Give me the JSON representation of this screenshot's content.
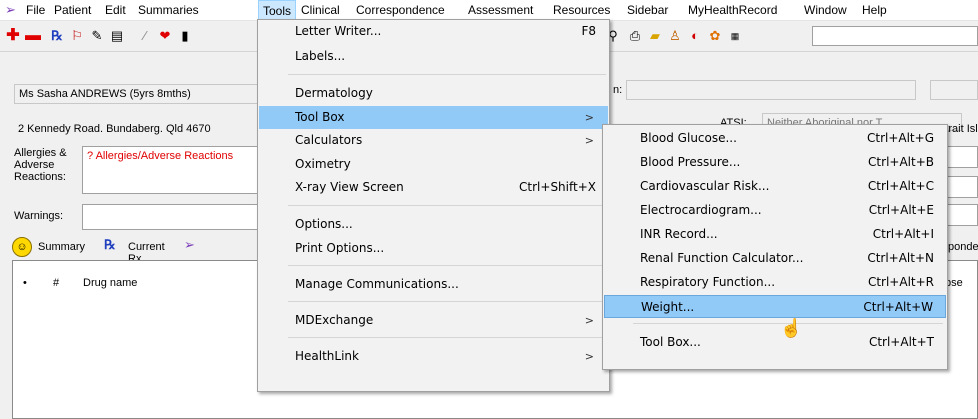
{
  "menubar": {
    "items": [
      "File",
      "Patient",
      "Edit",
      "Summaries",
      "Tools",
      "Clinical",
      "Correspondence",
      "Assessment",
      "Resources",
      "Sidebar",
      "MyHealthRecord",
      "Window",
      "Help"
    ]
  },
  "patient": {
    "name": "Ms Sasha ANDREWS (5yrs 8mths)",
    "address": "2 Kennedy Road. Bundaberg. Qld  4670",
    "allergies_label": "Allergies & Adverse Reactions:",
    "allergies_value": "? Allergies/Adverse Reactions",
    "warnings_label": "Warnings:",
    "atsi_label": "ATSI:",
    "atsi_value": "Neither Aboriginal nor T",
    "atsi_right": "Strait Isl",
    "partial_colon": "n:"
  },
  "tabs": {
    "summary": "Summary",
    "current_rx": "Current Rx",
    "right_partial": "ponde"
  },
  "list": {
    "col_bullet": "•",
    "col_hash": "#",
    "col_drug": "Drug name",
    "col_right": "pse"
  },
  "tools_menu": {
    "items": [
      {
        "label": "Letter Writer...",
        "shortcut": "F8"
      },
      {
        "label": "Labels..."
      },
      {
        "label": "Dermatology"
      },
      {
        "label": "Tool Box",
        "submenu": true
      },
      {
        "label": "Calculators",
        "submenu": true
      },
      {
        "label": "Oximetry"
      },
      {
        "label": "X-ray View Screen",
        "shortcut": "Ctrl+Shift+X"
      },
      {
        "label": "Options..."
      },
      {
        "label": "Print Options..."
      },
      {
        "label": "Manage Communications..."
      },
      {
        "label": "MDExchange",
        "submenu": true
      },
      {
        "label": "HealthLink",
        "submenu": true
      }
    ]
  },
  "toolbox_menu": {
    "items": [
      {
        "label": "Blood Glucose...",
        "shortcut": "Ctrl+Alt+G"
      },
      {
        "label": "Blood Pressure...",
        "shortcut": "Ctrl+Alt+B"
      },
      {
        "label": "Cardiovascular Risk...",
        "shortcut": "Ctrl+Alt+C"
      },
      {
        "label": "Electrocardiogram...",
        "shortcut": "Ctrl+Alt+E"
      },
      {
        "label": "INR Record...",
        "shortcut": "Ctrl+Alt+I"
      },
      {
        "label": "Renal Function Calculator...",
        "shortcut": "Ctrl+Alt+N"
      },
      {
        "label": "Respiratory Function...",
        "shortcut": "Ctrl+Alt+R"
      },
      {
        "label": "Weight...",
        "shortcut": "Ctrl+Alt+W"
      },
      {
        "label": "Tool Box...",
        "shortcut": "Ctrl+Alt+T"
      }
    ]
  },
  "colors": {
    "menu_highlight": "#91c9f7",
    "menubar_active": "#cce8ff",
    "allergy_text": "#e00000"
  }
}
